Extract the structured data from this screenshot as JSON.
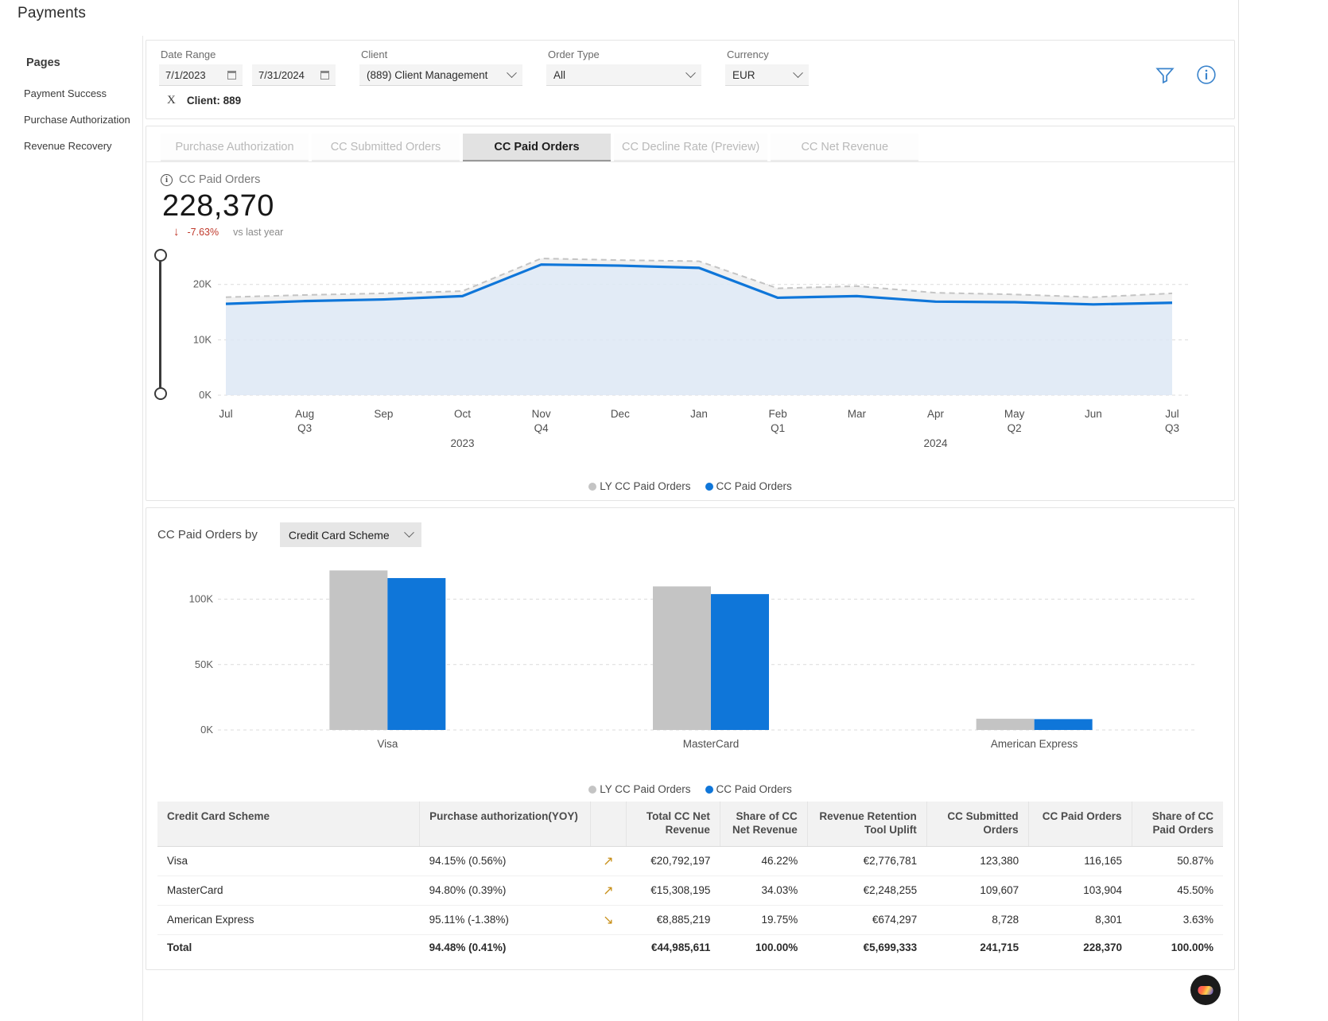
{
  "app": {
    "title": "Payments"
  },
  "sidebar": {
    "heading": "Pages",
    "items": [
      {
        "label": "Payment Success"
      },
      {
        "label": "Purchase Authorization"
      },
      {
        "label": "Revenue Recovery"
      }
    ]
  },
  "filters": {
    "date_range": {
      "label": "Date Range",
      "from": "7/1/2023",
      "to": "7/31/2024"
    },
    "client": {
      "label": "Client",
      "value": "(889) Client Management"
    },
    "order_type": {
      "label": "Order Type",
      "value": "All"
    },
    "currency": {
      "label": "Currency",
      "value": "EUR"
    },
    "chip": {
      "close": "X",
      "text": "Client: 889"
    },
    "filter_icon": "filter-icon",
    "info_icon": "info-icon"
  },
  "tabs": [
    {
      "label": "Purchase Authorization",
      "active": false
    },
    {
      "label": "CC Submitted Orders",
      "active": false
    },
    {
      "label": "CC Paid Orders",
      "active": true
    },
    {
      "label": "CC Decline Rate (Preview)",
      "active": false
    },
    {
      "label": "CC Net Revenue",
      "active": false
    }
  ],
  "kpi": {
    "title": "CC Paid Orders",
    "value": "228,370",
    "delta": "-7.63%",
    "delta_direction": "down",
    "comparison": "vs last year",
    "delta_color": "#c0392b"
  },
  "by_section": {
    "label": "CC Paid Orders by",
    "dimension": "Credit Card Scheme"
  },
  "colors": {
    "current": "#0f76d9",
    "last_year": "#c4c4c4",
    "area_fill": "#dde8f5",
    "accent_arrow": "#c8901a"
  },
  "chart_data": [
    {
      "type": "area",
      "title": "CC Paid Orders",
      "xlabel": "",
      "ylabel": "",
      "ylim": [
        0,
        27000
      ],
      "yticks": [
        0,
        10000,
        20000
      ],
      "ytick_labels": [
        "0K",
        "10K",
        "20K"
      ],
      "grid": true,
      "legend_position": "bottom",
      "x": [
        "Jul",
        "Aug",
        "Sep",
        "Oct",
        "Nov",
        "Dec",
        "Jan",
        "Feb",
        "Mar",
        "Apr",
        "May",
        "Jun",
        "Jul"
      ],
      "x_quarters": [
        {
          "index": 1,
          "label": "Q3"
        },
        {
          "index": 4,
          "label": "Q4"
        },
        {
          "index": 7,
          "label": "Q1"
        },
        {
          "index": 10,
          "label": "Q2"
        },
        {
          "index": 12,
          "label": "Q3"
        }
      ],
      "x_years": [
        {
          "index": 3,
          "label": "2023"
        },
        {
          "index": 9,
          "label": "2024"
        }
      ],
      "series": [
        {
          "name": "CC Paid Orders",
          "color": "#0f76d9",
          "style": "solid",
          "values": [
            16500,
            17000,
            17300,
            17900,
            23600,
            23400,
            23000,
            17600,
            17900,
            16900,
            16800,
            16400,
            16700
          ]
        },
        {
          "name": "LY CC Paid Orders",
          "color": "#c4c4c4",
          "style": "dashed",
          "values": [
            17700,
            18100,
            18400,
            18800,
            24700,
            24400,
            24200,
            19300,
            19700,
            18500,
            18200,
            17700,
            18400
          ]
        }
      ]
    },
    {
      "type": "bar",
      "title": "CC Paid Orders by Credit Card Scheme",
      "categories": [
        "Visa",
        "MasterCard",
        "American Express"
      ],
      "ylim": [
        0,
        135000
      ],
      "yticks": [
        0,
        50000,
        100000
      ],
      "ytick_labels": [
        "0K",
        "50K",
        "100K"
      ],
      "grid": true,
      "legend_position": "bottom",
      "series": [
        {
          "name": "LY CC Paid Orders",
          "color": "#c4c4c4",
          "values": [
            122000,
            109800,
            8600
          ]
        },
        {
          "name": "CC Paid Orders",
          "color": "#0f76d9",
          "values": [
            116165,
            103904,
            8301
          ]
        }
      ]
    }
  ],
  "legend": {
    "last_year": "LY CC Paid Orders",
    "current": "CC Paid Orders"
  },
  "table": {
    "columns": [
      "Credit Card Scheme",
      "Purchase authorization(YOY)",
      "",
      "Total CC Net Revenue",
      "Share of CC Net Revenue",
      "Revenue Retention Tool Uplift",
      "CC Submitted Orders",
      "CC Paid Orders",
      "Share of CC Paid Orders"
    ],
    "rows": [
      {
        "scheme": "Visa",
        "purchase_auth": "94.15% (0.56%)",
        "trend": "up",
        "total_net_revenue": "€20,792,197",
        "share_net_revenue": "46.22%",
        "retention_uplift": "€2,776,781",
        "submitted_orders": "123,380",
        "paid_orders": "116,165",
        "share_paid_orders": "50.87%"
      },
      {
        "scheme": "MasterCard",
        "purchase_auth": "94.80% (0.39%)",
        "trend": "up",
        "total_net_revenue": "€15,308,195",
        "share_net_revenue": "34.03%",
        "retention_uplift": "€2,248,255",
        "submitted_orders": "109,607",
        "paid_orders": "103,904",
        "share_paid_orders": "45.50%"
      },
      {
        "scheme": "American Express",
        "purchase_auth": "95.11% (-1.38%)",
        "trend": "down",
        "total_net_revenue": "€8,885,219",
        "share_net_revenue": "19.75%",
        "retention_uplift": "€674,297",
        "submitted_orders": "8,728",
        "paid_orders": "8,301",
        "share_paid_orders": "3.63%"
      }
    ],
    "total": {
      "scheme": "Total",
      "purchase_auth": "94.48% (0.41%)",
      "trend": "",
      "total_net_revenue": "€44,985,611",
      "share_net_revenue": "100.00%",
      "retention_uplift": "€5,699,333",
      "submitted_orders": "241,715",
      "paid_orders": "228,370",
      "share_paid_orders": "100.00%"
    }
  }
}
